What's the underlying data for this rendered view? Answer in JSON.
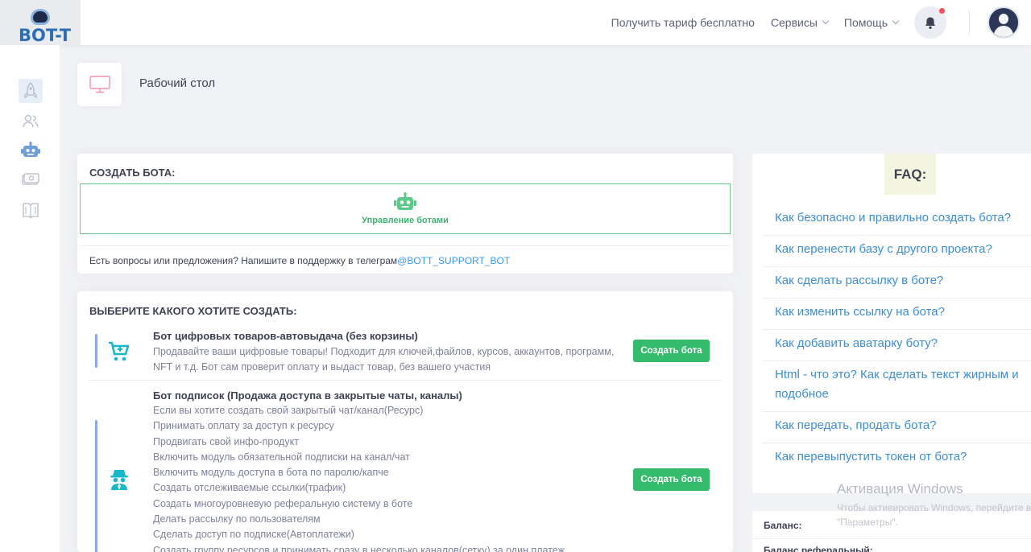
{
  "logo": {
    "text": "BOT-T"
  },
  "header": {
    "nav": [
      {
        "label": "Получить тариф бесплатно",
        "has_chevron": false
      },
      {
        "label": "Сервисы",
        "has_chevron": true
      },
      {
        "label": "Помощь",
        "has_chevron": true
      }
    ],
    "notification_dot_color": "#f64e60"
  },
  "sidebar": {
    "items": [
      {
        "icon": "rocket-icon",
        "active": true
      },
      {
        "icon": "users-icon",
        "active": false
      },
      {
        "icon": "robot-icon",
        "active": false
      },
      {
        "icon": "money-icon",
        "active": false
      },
      {
        "icon": "book-icon",
        "active": false
      }
    ]
  },
  "page": {
    "title": "Рабочий стол",
    "icon": "monitor-icon"
  },
  "create_card": {
    "title": "СОЗДАТЬ БОТА:",
    "manage_label": "Управление ботами",
    "support_text": "Есть вопросы или предложения? Напишите в поддержку в телеграм",
    "support_link": "@BOTT_SUPPORT_BOT"
  },
  "choose_card": {
    "title": "ВЫБЕРИТЕ КАКОГО ХОТИТЕ СОЗДАТЬ:",
    "bots": [
      {
        "name": "Бот цифровых товаров-автовыдача (без корзины)",
        "icon": "cart-plus-icon",
        "description": [
          "Продавайте ваши цифровые товары! Подходит для ключей,файлов, курсов, аккаунтов, программ,",
          "NFT и т.д. Бот сам проверит оплату и выдаст товар, без вашего участия"
        ],
        "button": "Создать бота"
      },
      {
        "name": "Бот подписок (Продажа доступа в закрытые чаты, каналы)",
        "icon": "spy-icon",
        "description": [
          "Если вы хотите создать свой закрытый чат/канал(Ресурс)",
          "Принимать оплату за доступ к ресурсу",
          "Продвигать свой инфо-продукт",
          "Включить модуль обязательной подписки на канал/чат",
          "Включить модуль доступа в бота по паролю/капче",
          "Создать отслеживаемые ссылки(трафик)",
          "Создать многоуровневую реферальную систему в боте",
          "Делать рассылку по пользователям",
          "Сделать доступ по подписке(Автоплатежи)",
          "Создать группу ресурсов и принимать сразу в несколько каналов(сетку) за один платеж"
        ],
        "button": "Создать бота"
      }
    ]
  },
  "faq": {
    "title": "FAQ:",
    "items": [
      "Как безопасно и правильно создать бота?",
      "Как перенести базу с другого проекта?",
      "Как сделать рассылку в боте?",
      "Как изменить ссылку на бота?",
      "Как добавить аватарку боту?",
      "Html - что это? Как сделать текст жирным и подобное",
      "Как передать, продать бота?",
      "Как перевыпустить токен от бота?"
    ]
  },
  "watermark": {
    "line1": "Активация Windows",
    "line2": "Чтобы активировать Windows, перейдите в раздел",
    "line3": "\"Параметры\"."
  },
  "balance_card": {
    "balance_label": "Баланс:",
    "referral_label": "Баланс реферальный:"
  },
  "colors": {
    "accent_green": "#34bb6c",
    "link_blue": "#3699ff",
    "faq_link": "#3e8ed4"
  }
}
